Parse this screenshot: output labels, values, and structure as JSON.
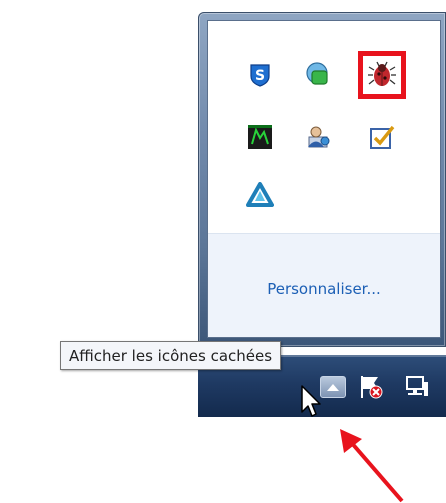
{
  "overflow_flyout": {
    "icons": [
      {
        "name": "s-shield-icon"
      },
      {
        "name": "green-chat-bubble-icon"
      },
      {
        "name": "bug-icon"
      },
      {
        "name": "green-terminal-icon"
      },
      {
        "name": "network-user-icon"
      },
      {
        "name": "checkbox-icon"
      },
      {
        "name": "triangle-logo-icon"
      }
    ],
    "customize_link": "Personnaliser..."
  },
  "tooltip": {
    "text": "Afficher les icônes cachées"
  },
  "taskbar": {
    "show_hidden_icon": "up-arrow-icon",
    "tray_icons": [
      "flag-error-icon",
      "network-icon"
    ]
  },
  "colors": {
    "highlight": "#e8131d",
    "link": "#1c5fb5",
    "taskbar": "#1f3a63",
    "annotation_arrow": "#e8131d"
  }
}
